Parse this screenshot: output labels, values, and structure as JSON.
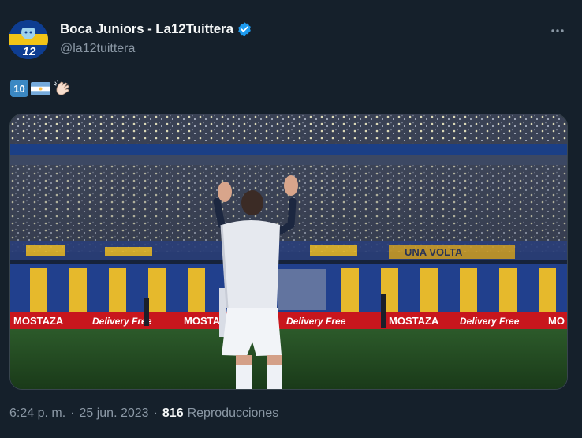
{
  "tweet": {
    "author": {
      "display_name": "Boca Juniors - La12Tuittera",
      "handle": "@la12tuittera",
      "avatar_number": "12",
      "verified": true,
      "verified_color": "#1d9bf0"
    },
    "content_emojis": [
      "keycap-10-emoji",
      "argentina-flag-emoji",
      "clapping-hands-emoji"
    ],
    "media": {
      "type": "photo",
      "banner_texts": [
        "MOSTAZA",
        "Delivery Free",
        "MOSTAZA",
        "Delivery Free",
        "MOSTAZA",
        "Delivery Free",
        "MO"
      ],
      "tifo_text": "UNA VOLTA"
    },
    "meta": {
      "time": "6:24 p. m.",
      "separator": "·",
      "date": "25 jun. 2023",
      "views_count": "816",
      "views_label": "Reproducciones"
    }
  },
  "colors": {
    "background": "#15202b",
    "text_primary": "#f7f9f9",
    "text_secondary": "#8b98a5",
    "border": "#38444d",
    "boca_blue": "#1a3a8f",
    "boca_gold": "#e8b923"
  }
}
